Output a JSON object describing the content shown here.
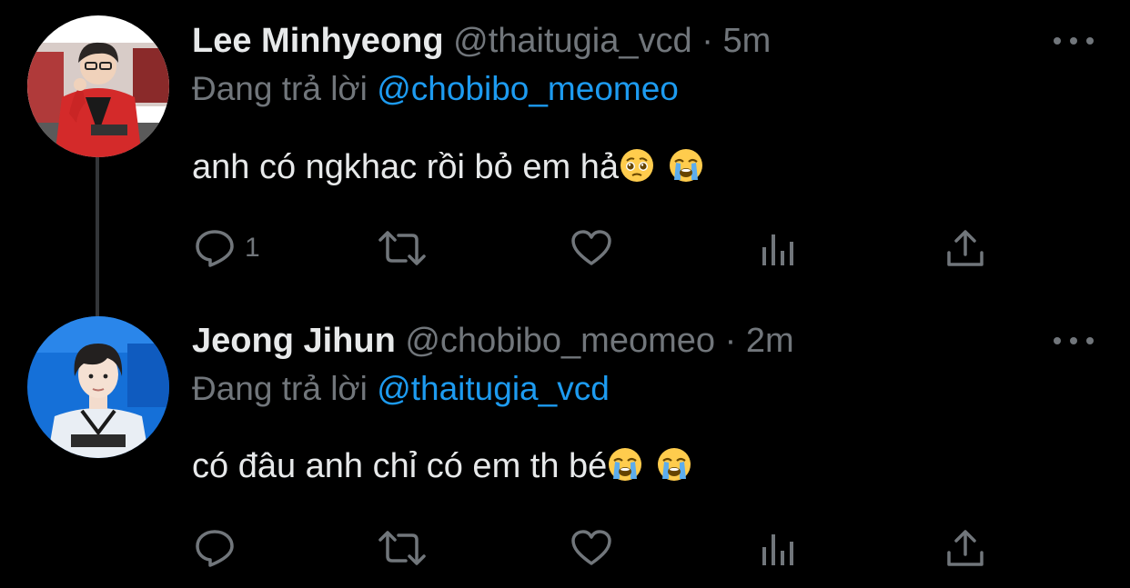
{
  "tweets": [
    {
      "display_name": "Lee Minhyeong",
      "handle": "@thaitugia_vcd",
      "separator": "·",
      "time": "5m",
      "reply_label": "Đang trả lời",
      "reply_mention": "@chobibo_meomeo",
      "text": "anh có ngkhac rồi bỏ em hả",
      "emojis": [
        "pleading-face-emoji",
        "loudly-crying-face-emoji"
      ],
      "reply_count": "1"
    },
    {
      "display_name": "Jeong Jihun",
      "handle": "@chobibo_meomeo",
      "separator": "·",
      "time": "2m",
      "reply_label": "Đang trả lời",
      "reply_mention": "@thaitugia_vcd",
      "text": "có đâu anh chỉ có em th bé",
      "emojis": [
        "loudly-crying-face-emoji",
        "loudly-crying-face-emoji"
      ],
      "reply_count": ""
    }
  ],
  "icons": {
    "reply": "reply-icon",
    "retweet": "retweet-icon",
    "like": "heart-icon",
    "views": "views-icon",
    "share": "share-icon",
    "more": "more-icon"
  },
  "colors": {
    "background": "#000000",
    "primary_text": "#e7e9ea",
    "secondary_text": "#71767b",
    "accent": "#1d9bf0",
    "thread_line": "#333639"
  }
}
